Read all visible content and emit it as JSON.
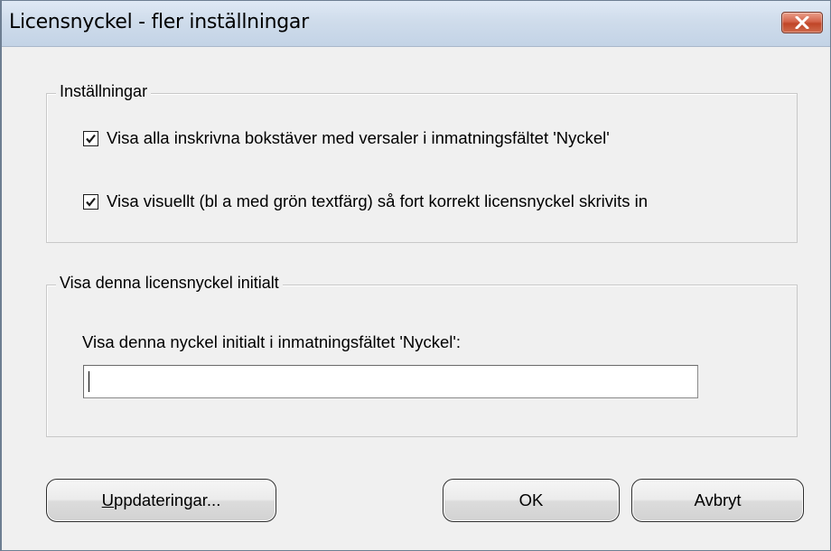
{
  "window": {
    "title": "Licensnyckel - fler inställningar",
    "close_icon": "close-icon"
  },
  "settings_group": {
    "legend": "Inställningar",
    "checkboxes": [
      {
        "label": "Visa alla inskrivna bokstäver med versaler i inmatningsfältet 'Nyckel'",
        "checked": true
      },
      {
        "label": "Visa visuellt (bl a med grön textfärg) så fort korrekt licensnyckel skrivits in",
        "checked": true
      }
    ]
  },
  "initial_key_group": {
    "legend": "Visa denna licensnyckel initialt",
    "field_label": "Visa denna nyckel initialt i inmatningsfältet 'Nyckel':",
    "field_value": ""
  },
  "buttons": {
    "updates": "Uppdateringar...",
    "ok": "OK",
    "cancel": "Avbryt"
  },
  "colors": {
    "dialog_bg": "#f0f0f0",
    "titlebar": "#cfdceb",
    "close_button": "#c04628"
  }
}
